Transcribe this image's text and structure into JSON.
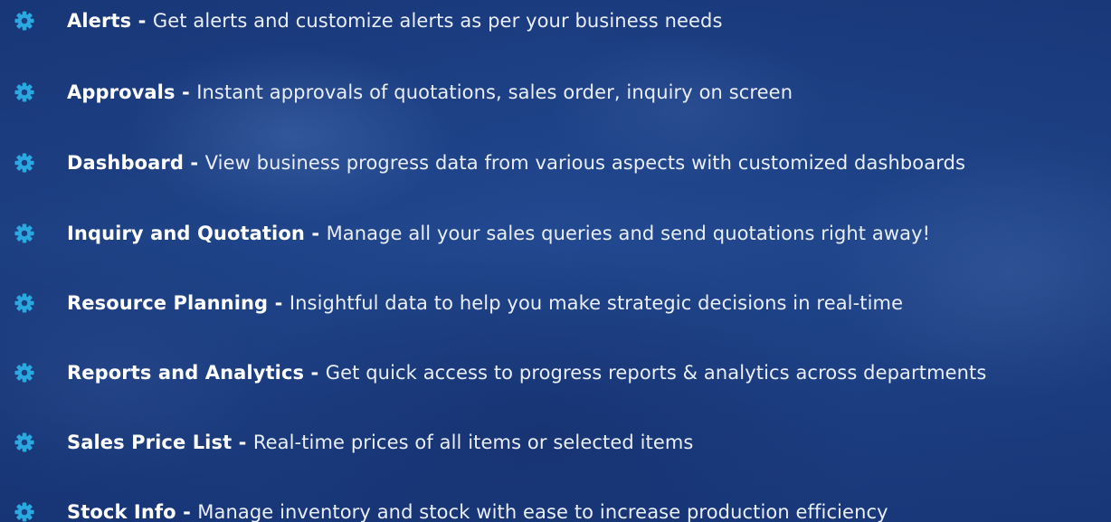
{
  "colors": {
    "background": "#1d3f84",
    "icon": "#2aa9e0",
    "text": "#ffffff"
  },
  "icon_name": "gear-icon",
  "separator": " - ",
  "features": [
    {
      "title": "Alerts",
      "description": "Get alerts and customize alerts as per your business needs"
    },
    {
      "title": "Approvals",
      "description": "Instant approvals of quotations, sales order, inquiry on screen"
    },
    {
      "title": "Dashboard",
      "description": "View business progress data from various aspects with customized dashboards"
    },
    {
      "title": "Inquiry and Quotation",
      "description": "Manage all your sales queries and send quotations right away!"
    },
    {
      "title": "Resource Planning",
      "description": "Insightful data to help you make strategic decisions in real-time"
    },
    {
      "title": "Reports and Analytics",
      "description": "Get quick access to progress reports & analytics across departments"
    },
    {
      "title": "Sales Price List",
      "description": "Real-time prices of all items or selected items"
    },
    {
      "title": "Stock Info",
      "description": "Manage inventory and stock with ease to increase production efficiency"
    }
  ]
}
